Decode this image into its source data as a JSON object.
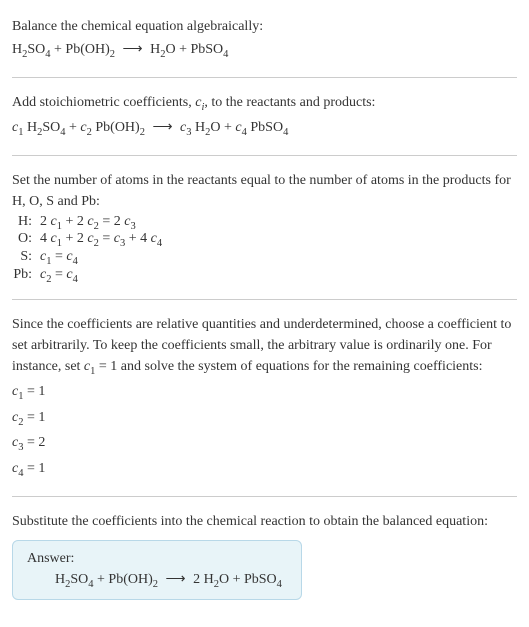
{
  "section1": {
    "title": "Balance the chemical equation algebraically:",
    "equation_html": "H<sub>2</sub>SO<sub>4</sub> + Pb(OH)<sub>2</sub> <span class='arrow'>⟶</span> H<sub>2</sub>O + PbSO<sub>4</sub>"
  },
  "section2": {
    "text_html": "Add stoichiometric coefficients, <span class='italic'>c<sub>i</sub></span>, to the reactants and products:",
    "equation_html": "<span class='italic'>c</span><sub>1</sub> H<sub>2</sub>SO<sub>4</sub> + <span class='italic'>c</span><sub>2</sub> Pb(OH)<sub>2</sub> <span class='arrow'>⟶</span> <span class='italic'>c</span><sub>3</sub> H<sub>2</sub>O + <span class='italic'>c</span><sub>4</sub> PbSO<sub>4</sub>"
  },
  "section3": {
    "text": "Set the number of atoms in the reactants equal to the number of atoms in the products for H, O, S and Pb:",
    "rows": [
      {
        "label": "H:",
        "expr_html": "2 <span class='italic'>c</span><sub>1</sub> + 2 <span class='italic'>c</span><sub>2</sub> = 2 <span class='italic'>c</span><sub>3</sub>"
      },
      {
        "label": "O:",
        "expr_html": "4 <span class='italic'>c</span><sub>1</sub> + 2 <span class='italic'>c</span><sub>2</sub> = <span class='italic'>c</span><sub>3</sub> + 4 <span class='italic'>c</span><sub>4</sub>"
      },
      {
        "label": "S:",
        "expr_html": "<span class='italic'>c</span><sub>1</sub> = <span class='italic'>c</span><sub>4</sub>"
      },
      {
        "label": "Pb:",
        "expr_html": "<span class='italic'>c</span><sub>2</sub> = <span class='italic'>c</span><sub>4</sub>"
      }
    ]
  },
  "section4": {
    "text_html": "Since the coefficients are relative quantities and underdetermined, choose a coefficient to set arbitrarily. To keep the coefficients small, the arbitrary value is ordinarily one. For instance, set <span class='italic'>c</span><sub>1</sub> = 1 and solve the system of equations for the remaining coefficients:",
    "solutions": [
      "<span class='italic'>c</span><sub>1</sub> = 1",
      "<span class='italic'>c</span><sub>2</sub> = 1",
      "<span class='italic'>c</span><sub>3</sub> = 2",
      "<span class='italic'>c</span><sub>4</sub> = 1"
    ]
  },
  "section5": {
    "text": "Substitute the coefficients into the chemical reaction to obtain the balanced equation:",
    "answer_label": "Answer:",
    "answer_eq_html": "H<sub>2</sub>SO<sub>4</sub> + Pb(OH)<sub>2</sub> <span class='arrow'>⟶</span> 2 H<sub>2</sub>O + PbSO<sub>4</sub>"
  }
}
